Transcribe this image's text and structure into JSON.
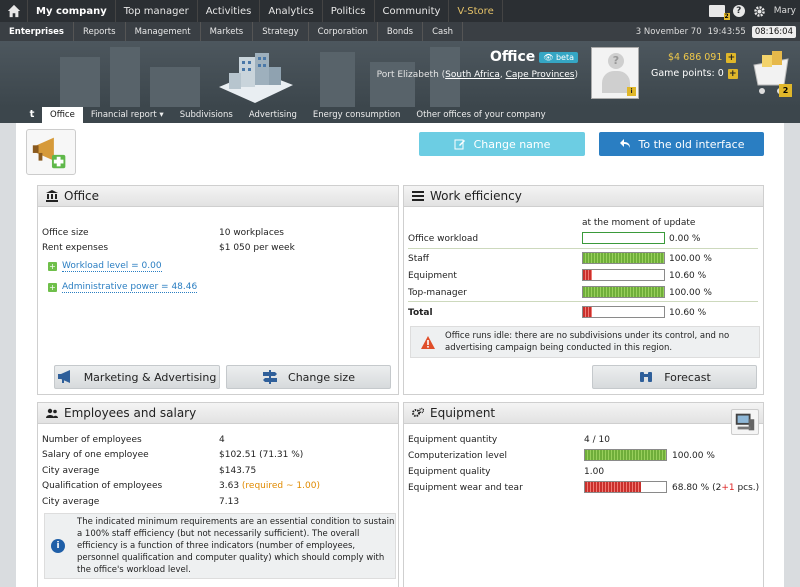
{
  "topnav": {
    "items": [
      "My company",
      "Top manager",
      "Activities",
      "Analytics",
      "Politics",
      "Community",
      "V-Store"
    ],
    "mail_count": "2",
    "user": "Mary"
  },
  "subnav": {
    "items": [
      "Enterprises",
      "Reports",
      "Management",
      "Markets",
      "Strategy",
      "Corporation",
      "Bonds",
      "Cash"
    ],
    "date": "3 November 70",
    "time": "19:43:55",
    "time_box": "08:16:04"
  },
  "banner": {
    "title": "Office",
    "beta": "beta",
    "location_prefix": "Port Elizabeth (",
    "country": "South Africa",
    "separator": ", ",
    "region": "Cape Provinces",
    "location_suffix": ")",
    "money": "$4 686 091",
    "game_points": "Game points: 0",
    "cart_count": "2",
    "avatar_tag": "i"
  },
  "tabs": {
    "t": "t",
    "items": [
      "Office",
      "Financial report",
      "Subdivisions",
      "Advertising",
      "Energy consumption",
      "Other offices of your company"
    ]
  },
  "actions": {
    "change_name": "Change name",
    "old_interface": "To the old interface"
  },
  "office": {
    "title": "Office",
    "size_label": "Office size",
    "size_value": "10 workplaces",
    "rent_label": "Rent expenses",
    "rent_value": "$1 050 per week",
    "workload_link": "Workload level = 0.00",
    "admin_link": "Administrative power = 48.46",
    "marketing_btn": "Marketing & Advertising",
    "change_size_btn": "Change size"
  },
  "efficiency": {
    "title": "Work efficiency",
    "moment": "at the moment of update",
    "rows": [
      {
        "label": "Office workload",
        "value": "0.00 %",
        "fraction": 0.0
      },
      {
        "label": "Staff",
        "value": "100.00 %",
        "fraction": 1.0
      },
      {
        "label": "Equipment",
        "value": "10.60 %",
        "fraction": 0.106
      },
      {
        "label": "Top-manager",
        "value": "100.00 %",
        "fraction": 1.0
      }
    ],
    "total_label": "Total",
    "total_value": "10.60 %",
    "total_fraction": 0.106,
    "warning": "Office runs idle: there are no subdivisions under its control, and no advertising campaign being conducted in this region.",
    "forecast_btn": "Forecast"
  },
  "employees": {
    "title": "Employees and salary",
    "rows": [
      {
        "label": "Number of employees",
        "value": "4"
      },
      {
        "label": "Salary of one employee",
        "value": "$102.51 (71.31 %)"
      },
      {
        "label": "City average",
        "value": "$143.75"
      },
      {
        "label": "Qualification of employees",
        "value": "3.63"
      },
      {
        "label": "City average",
        "value": "7.13"
      }
    ],
    "required": "(required ~ 1.00)",
    "info": "The indicated minimum requirements are an essential condition to sustain a 100% staff efficiency (but not necessarily sufficient). The overall efficiency is a function of three indicators (number of employees, personnel qualification and computer quality) which should comply with the office's workload level."
  },
  "equipment": {
    "title": "Equipment",
    "rows": [
      {
        "label": "Equipment quantity",
        "value": "4 / 10"
      },
      {
        "label": "Computerization level",
        "value": "100.00 %",
        "fraction": 1.0
      },
      {
        "label": "Equipment quality",
        "value": "1.00"
      },
      {
        "label": "Equipment wear and tear",
        "value": "68.80 %",
        "fraction": 0.688
      }
    ],
    "wear_extra_open": "(2",
    "wear_extra_plus": "+1",
    "wear_extra_close": " pcs.)"
  }
}
